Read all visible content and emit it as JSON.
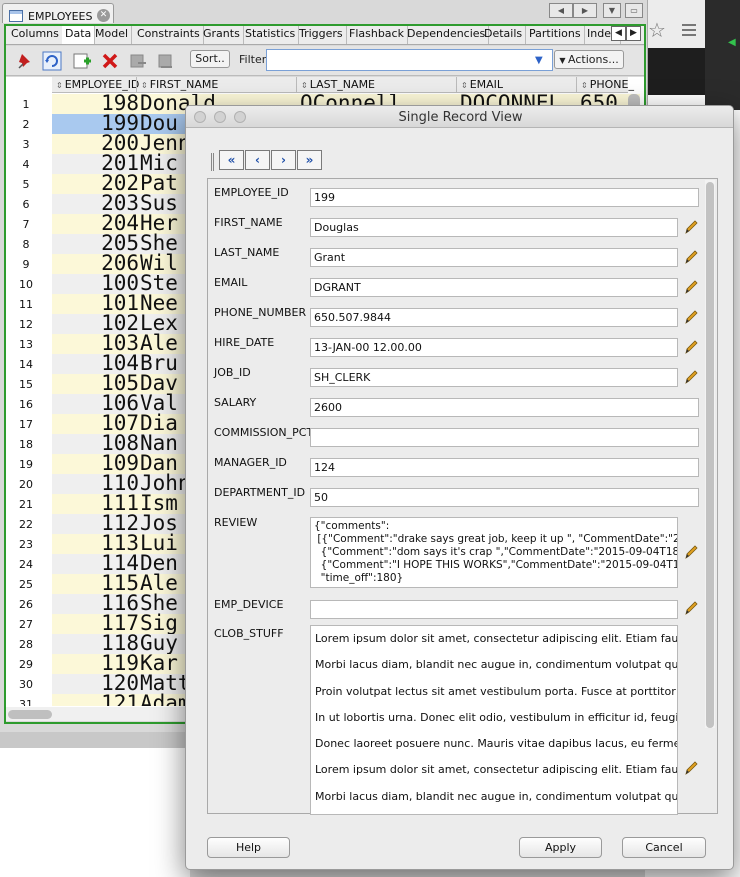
{
  "editor": {
    "tab_title": "EMPLOYEES",
    "tabs": [
      "Columns",
      "Data",
      "Model",
      "Constraints",
      "Grants",
      "Statistics",
      "Triggers",
      "Flashback",
      "Dependencies",
      "Details",
      "Partitions",
      "Index"
    ],
    "active_tab": "Data",
    "sort_label": "Sort..",
    "filter_label": "Filter:",
    "filter_value": "",
    "actions_label": "Actions...",
    "columns": [
      "EMPLOYEE_ID",
      "FIRST_NAME",
      "LAST_NAME",
      "EMAIL",
      "PHONE_"
    ],
    "first_row_extra": {
      "last_name": "OConnell",
      "email": "DOCONNEL",
      "phone": "650"
    },
    "rows": [
      {
        "n": "1",
        "id": "198",
        "name": "Donald"
      },
      {
        "n": "2",
        "id": "199",
        "name": "Dou"
      },
      {
        "n": "3",
        "id": "200",
        "name": "Jenn"
      },
      {
        "n": "4",
        "id": "201",
        "name": "Mic"
      },
      {
        "n": "5",
        "id": "202",
        "name": "Pat"
      },
      {
        "n": "6",
        "id": "203",
        "name": "Sus"
      },
      {
        "n": "7",
        "id": "204",
        "name": "Her"
      },
      {
        "n": "8",
        "id": "205",
        "name": "She"
      },
      {
        "n": "9",
        "id": "206",
        "name": "Wil"
      },
      {
        "n": "10",
        "id": "100",
        "name": "Ste"
      },
      {
        "n": "11",
        "id": "101",
        "name": "Nee"
      },
      {
        "n": "12",
        "id": "102",
        "name": "Lex"
      },
      {
        "n": "13",
        "id": "103",
        "name": "Ale"
      },
      {
        "n": "14",
        "id": "104",
        "name": "Bru"
      },
      {
        "n": "15",
        "id": "105",
        "name": "Dav"
      },
      {
        "n": "16",
        "id": "106",
        "name": "Val"
      },
      {
        "n": "17",
        "id": "107",
        "name": "Dia"
      },
      {
        "n": "18",
        "id": "108",
        "name": "Nan"
      },
      {
        "n": "19",
        "id": "109",
        "name": "Dan"
      },
      {
        "n": "20",
        "id": "110",
        "name": "John"
      },
      {
        "n": "21",
        "id": "111",
        "name": "Ism"
      },
      {
        "n": "22",
        "id": "112",
        "name": "Jos"
      },
      {
        "n": "23",
        "id": "113",
        "name": "Lui"
      },
      {
        "n": "24",
        "id": "114",
        "name": "Den"
      },
      {
        "n": "25",
        "id": "115",
        "name": "Ale"
      },
      {
        "n": "26",
        "id": "116",
        "name": "She"
      },
      {
        "n": "27",
        "id": "117",
        "name": "Sig"
      },
      {
        "n": "28",
        "id": "118",
        "name": "Guy"
      },
      {
        "n": "29",
        "id": "119",
        "name": "Kar"
      },
      {
        "n": "30",
        "id": "120",
        "name": "Matt"
      },
      {
        "n": "31",
        "id": "121",
        "name": "Adam"
      }
    ],
    "selected_row": 2
  },
  "dialog": {
    "title": "Single Record View",
    "fields": [
      {
        "label": "EMPLOYEE_ID",
        "value": "199",
        "editable": false
      },
      {
        "label": "FIRST_NAME",
        "value": "Douglas",
        "editable": true
      },
      {
        "label": "LAST_NAME",
        "value": "Grant",
        "editable": true
      },
      {
        "label": "EMAIL",
        "value": "DGRANT",
        "editable": true
      },
      {
        "label": "PHONE_NUMBER",
        "value": "650.507.9844",
        "editable": true
      },
      {
        "label": "HIRE_DATE",
        "value": "13-JAN-00 12.00.00",
        "editable": true
      },
      {
        "label": "JOB_ID",
        "value": "SH_CLERK",
        "editable": true
      },
      {
        "label": "SALARY",
        "value": "2600",
        "editable": false
      },
      {
        "label": "COMMISSION_PCT",
        "value": "",
        "editable": false
      },
      {
        "label": "MANAGER_ID",
        "value": "124",
        "editable": false
      },
      {
        "label": "DEPARTMENT_ID",
        "value": "50",
        "editable": false
      }
    ],
    "review_label": "REVIEW",
    "review_text": "{\"comments\":\n [{\"Comment\":\"drake says great job, keep it up \", \"CommentDate\":\"2015-09-04T18\n  {\"Comment\":\"dom says it's crap \",\"CommentDate\":\"2015-09-04T18:18:43\n  {\"Comment\":\"I HOPE THIS WORKS\",\"CommentDate\":\"2015-09-04T19:06:34\n  \"time_off\":180}",
    "emp_device_label": "EMP_DEVICE",
    "emp_device_value": "",
    "clob_label": "CLOB_STUFF",
    "clob_lines": [
      "Lorem ipsum dolor sit amet, consectetur adipiscing elit. Etiam faucibus tristique",
      "Morbi lacus diam, blandit nec augue in, condimentum volutpat quam. In imperdiet",
      "Proin volutpat lectus sit amet vestibulum porta. Fusce at porttitor ligula. Pellentesque",
      "In ut lobortis urna. Donec elit odio, vestibulum in efficitur id, feugiat ut erat.",
      "Donec laoreet posuere nunc. Mauris vitae dapibus lacus, eu fermentum dolor.",
      "Lorem ipsum dolor sit amet, consectetur adipiscing elit. Etiam faucibus tristique",
      "Morbi lacus diam, blandit nec augue in, condimentum volutpat quam. In imperdiet"
    ],
    "buttons": {
      "help": "Help",
      "apply": "Apply",
      "cancel": "Cancel"
    }
  }
}
